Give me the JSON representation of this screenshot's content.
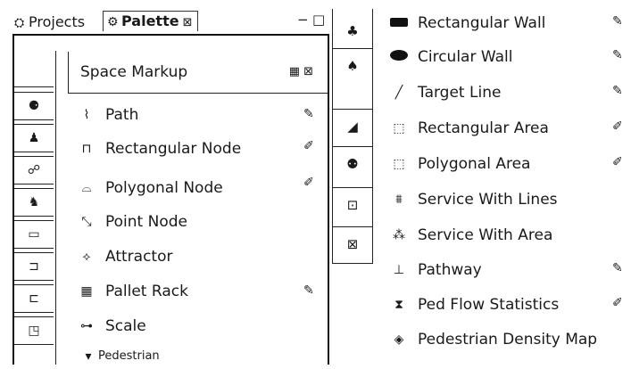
{
  "tabs": {
    "projects_label": "Projects",
    "palette_label": "Palette",
    "palette_close": "⊠"
  },
  "window_controls": {
    "minimize": "−",
    "maximize": "□"
  },
  "section": {
    "title": "Space Markup",
    "ctrl_grid": "▦",
    "ctrl_close": "⊠"
  },
  "left_items": [
    {
      "label": "Path",
      "icon": "path-icon",
      "edit": "pencil"
    },
    {
      "label": "Rectangular Node",
      "icon": "rectangular-node-icon",
      "edit": "pencil-bar"
    },
    {
      "label": "Polygonal Node",
      "icon": "polygonal-node-icon",
      "edit": "pencil-bar"
    },
    {
      "label": "Point Node",
      "icon": "point-node-icon",
      "edit": ""
    },
    {
      "label": "Attractor",
      "icon": "attractor-icon",
      "edit": ""
    },
    {
      "label": "Pallet Rack",
      "icon": "pallet-rack-icon",
      "edit": "pencil"
    },
    {
      "label": "Scale",
      "icon": "scale-icon",
      "edit": ""
    },
    {
      "label": "Pedestrian",
      "icon": "triangle-down-icon",
      "edit": ""
    }
  ],
  "right_items": [
    {
      "label": "Rectangular Wall",
      "icon": "rectangular-wall-icon",
      "edit": "pencil"
    },
    {
      "label": "Circular Wall",
      "icon": "circular-wall-icon",
      "edit": "pencil"
    },
    {
      "label": "Target Line",
      "icon": "target-line-icon",
      "edit": "pencil"
    },
    {
      "label": "Rectangular Area",
      "icon": "rectangular-area-icon",
      "edit": "pencil-bar"
    },
    {
      "label": "Polygonal Area",
      "icon": "polygonal-area-icon",
      "edit": "pencil-bar"
    },
    {
      "label": "Service With Lines",
      "icon": "service-lines-icon",
      "edit": ""
    },
    {
      "label": "Service With Area",
      "icon": "service-area-icon",
      "edit": ""
    },
    {
      "label": "Pathway",
      "icon": "pathway-icon",
      "edit": "pencil"
    },
    {
      "label": "Ped Flow Statistics",
      "icon": "ped-flow-icon",
      "edit": "pencil-bar"
    },
    {
      "label": "Pedestrian Density Map",
      "icon": "density-map-icon",
      "edit": ""
    }
  ]
}
